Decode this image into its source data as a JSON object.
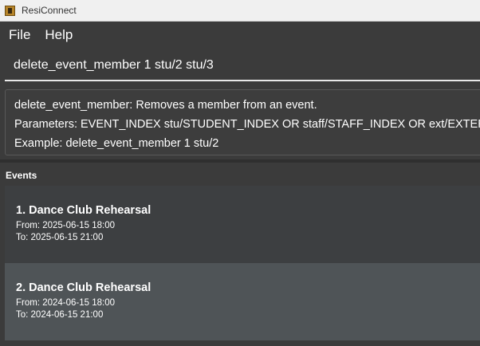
{
  "window": {
    "title": "ResiConnect"
  },
  "menu": {
    "items": [
      "File",
      "Help"
    ]
  },
  "command": {
    "value": "delete_event_member 1 stu/2 stu/3"
  },
  "result": {
    "lines": [
      "delete_event_member: Removes a member from an event.",
      "Parameters: EVENT_INDEX stu/STUDENT_INDEX OR staff/STAFF_INDEX OR ext/EXTERNAL_INDEX",
      "Example: delete_event_member 1 stu/2"
    ]
  },
  "events": {
    "label": "Events",
    "items": [
      {
        "title": "1.  Dance Club Rehearsal",
        "from": "From:  2025-06-15 18:00",
        "to": "To:  2025-06-15 21:00"
      },
      {
        "title": "2.  Dance Club Rehearsal",
        "from": "From:  2024-06-15 18:00",
        "to": "To:  2024-06-15 21:00"
      }
    ]
  }
}
